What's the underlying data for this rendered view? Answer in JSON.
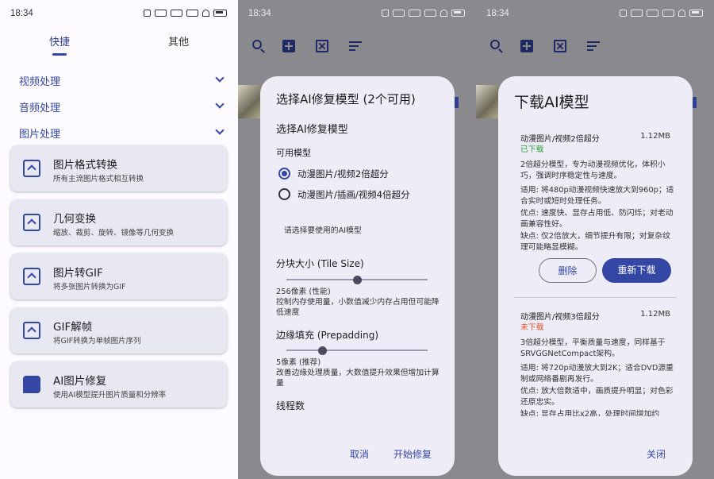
{
  "status_time": "18:34",
  "screen1": {
    "tabs": [
      "快捷",
      "其他"
    ],
    "categories": [
      "视频处理",
      "音频处理",
      "图片处理"
    ],
    "cards": [
      {
        "title": "图片格式转换",
        "desc": "所有主流图片格式相互转换"
      },
      {
        "title": "几何变换",
        "desc": "缩放、裁剪、旋转、镜像等几何变换"
      },
      {
        "title": "图片转GIF",
        "desc": "将多张图片转换为GIF"
      },
      {
        "title": "GIF解帧",
        "desc": "将GIF转换为单帧图片序列"
      },
      {
        "title": "AI图片修复",
        "desc": "使用AI模型提升图片质量和分辨率"
      }
    ]
  },
  "screen2": {
    "dialog_title": "选择AI修复模型 (2个可用)",
    "section_title": "选择AI修复模型",
    "available_label": "可用模型",
    "options": [
      "动漫图片/视频2倍超分",
      "动漫图片/插画/视频4倍超分"
    ],
    "selected_index": 0,
    "hint": "请选择要使用的AI模型",
    "tile_label": "分块大小 (Tile Size)",
    "tile_value": "256像素 (性能)",
    "tile_desc": "控制内存使用量，小数值减少内存占用但可能降低速度",
    "tile_slider_fraction": 0.5,
    "prepad_label": "边缘填充 (Prepadding)",
    "prepad_value": "5像素 (推荐)",
    "prepad_desc": "改善边缘处理质量，大数值提升效果但增加计算量",
    "prepad_slider_fraction": 0.25,
    "threads_label": "线程数",
    "cancel": "取消",
    "start": "开始修复"
  },
  "screen3": {
    "dialog_title": "下载AI模型",
    "models": [
      {
        "name": "动漫图片/视频2倍超分",
        "size": "1.12MB",
        "status": "已下载",
        "status_color": "#2e9d3e",
        "desc": "2倍超分模型，专为动漫视频优化，体积小巧，强调时序稳定性与速度。",
        "use": "适用: 将480p动漫视频快速放大到960p；适合实时或短时处理任务。",
        "pros": "优点: 速度快、显存占用低、防闪烁；对老动画兼容性好。",
        "cons": "缺点: 仅2倍放大，细节提升有限；对复杂纹理可能略显模糊。"
      },
      {
        "name": "动漫图片/视频3倍超分",
        "size": "1.12MB",
        "status": "未下载",
        "status_color": "#e0502c",
        "desc": "3倍超分模型，平衡质量与速度，同样基于SRVGGNetCompact架构。",
        "use": "适用: 将720p动漫放大到2K；适合DVD源重制或网络番剧再发行。",
        "pros": "优点: 放大倍数适中，画质提升明显；对色彩还原忠实。",
        "cons": "缺点: 显存占用比x2高，处理时间增加约"
      }
    ],
    "delete": "删除",
    "redownload": "重新下载",
    "close": "关闭"
  }
}
